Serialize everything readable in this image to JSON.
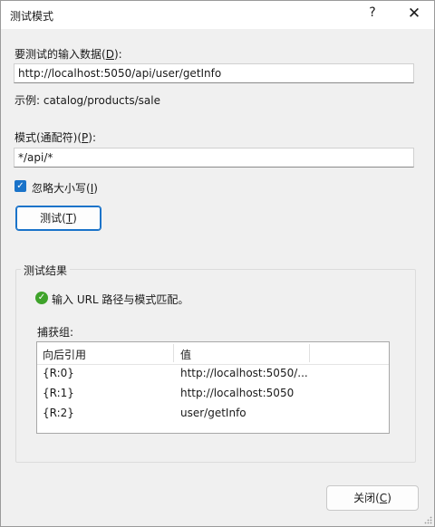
{
  "dialog": {
    "title": "测试模式",
    "help_glyph": "?",
    "close_glyph": "✕"
  },
  "input": {
    "label_prefix": "要测试的输入数据(",
    "label_key": "D",
    "label_suffix": "):",
    "value": "http://localhost:5050/api/user/getInfo",
    "example": "示例: catalog/products/sale"
  },
  "pattern": {
    "label_prefix": "模式(通配符)(",
    "label_key": "P",
    "label_suffix": "):",
    "value": "*/api/*"
  },
  "ignore_case": {
    "checked": true,
    "label_prefix": "忽略大小写(",
    "label_key": "I",
    "label_suffix": ")"
  },
  "test_button": {
    "label_prefix": "测试(",
    "label_key": "T",
    "label_suffix": ")"
  },
  "results": {
    "group_title": "测试结果",
    "message": "输入 URL 路径与模式匹配。",
    "captures_label": "捕获组:",
    "columns": [
      "向后引用",
      "值"
    ],
    "rows": [
      {
        "ref": "{R:0}",
        "value": "http://localhost:5050/..."
      },
      {
        "ref": "{R:1}",
        "value": "http://localhost:5050"
      },
      {
        "ref": "{R:2}",
        "value": "user/getInfo"
      }
    ]
  },
  "close_button": {
    "label_prefix": "关闭(",
    "label_key": "C",
    "label_suffix": ")"
  }
}
